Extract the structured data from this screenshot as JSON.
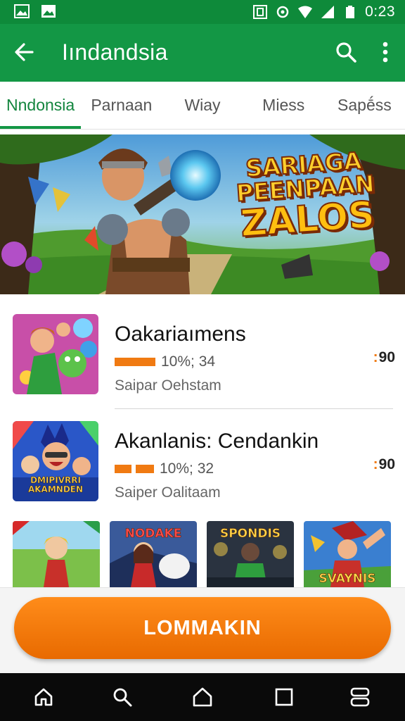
{
  "status_bar": {
    "time": "0:23",
    "left_icons": [
      "image-icon",
      "image-icon"
    ],
    "right_icons": [
      "nfc-icon",
      "sync-icon",
      "wifi-icon",
      "signal-icon",
      "battery-icon"
    ]
  },
  "app_bar": {
    "title": "Iındandsia",
    "background": "#139745",
    "icons": [
      "back-arrow-icon",
      "search-icon",
      "more-vert-icon"
    ]
  },
  "tabs": [
    {
      "label": "Nndonsia",
      "active": true
    },
    {
      "label": "Parnaan",
      "active": false
    },
    {
      "label": "Wiay",
      "active": false
    },
    {
      "label": "Miess",
      "active": false
    },
    {
      "label": "Sapḗss",
      "active": false
    }
  ],
  "banner": {
    "line1": "SARIAGA",
    "line2": "PEENPAAN",
    "line3": "ZALOS"
  },
  "list": [
    {
      "title": "Oakariaımens",
      "rating": "10%; 34",
      "subtitle": "Saipar Oehstam",
      "badge": "90",
      "badge_dots": ":"
    },
    {
      "title": "Akanlanis: Cendankin",
      "rating": "10%; 32",
      "subtitle": "Saiper Oalitaam",
      "badge": "90",
      "badge_dots": ":"
    }
  ],
  "thumb_2_label": {
    "line1": "DMIPIVRRI",
    "line2": "AKAMNDEN"
  },
  "games": [
    {
      "label": ""
    },
    {
      "label": "NODAKE"
    },
    {
      "label": "SPONDIS"
    },
    {
      "label": "SVAYNIS"
    }
  ],
  "cta": {
    "label": "LOMMAKIN",
    "color": "#f07a12"
  },
  "nav_bar": {
    "icons": [
      "home-outline-icon",
      "search-icon",
      "home-icon",
      "square-icon",
      "recents-icon"
    ]
  },
  "colors": {
    "primary": "#139745",
    "status_bar": "#0e8a3a",
    "accent": "#f07a12"
  }
}
